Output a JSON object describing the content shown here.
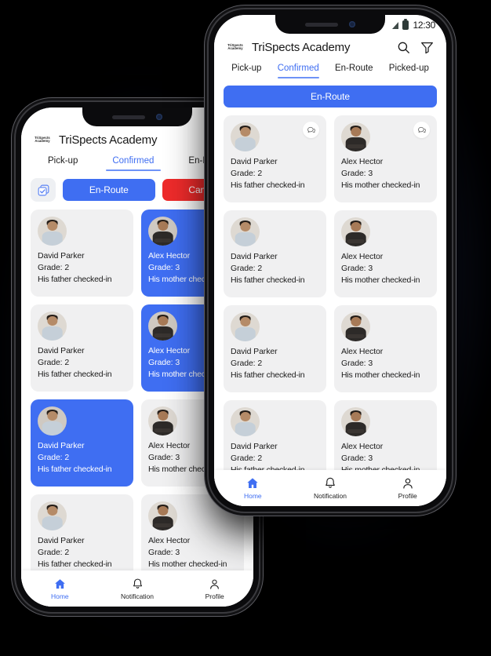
{
  "background_color": "#000000",
  "accent_color": "#3f6ef2",
  "danger_color": "#ee2b2b",
  "card_color": "#f0f0f1",
  "status_bar": {
    "time": "12:30",
    "signal_icon": "signal-icon",
    "battery_icon": "battery-icon"
  },
  "header": {
    "logo_line1": "TriSpects",
    "logo_line2": "Academy",
    "title": "TriSpects Academy",
    "search_icon": "search-icon",
    "filter_icon": "filter-icon"
  },
  "tabs": [
    {
      "label": "Pick-up",
      "active": false
    },
    {
      "label": "Confirmed",
      "active": true
    },
    {
      "label": "En-Route",
      "active": false
    },
    {
      "label": "Picked-up",
      "active": false
    }
  ],
  "front_phone": {
    "primary_action": {
      "label": "En-Route"
    }
  },
  "back_phone": {
    "select_all_icon": "select-all-checkbox-icon",
    "primary_action": {
      "label": "En-Route"
    },
    "secondary_action": {
      "label": "Cancel"
    }
  },
  "students": {
    "david": {
      "name": "David Parker",
      "grade": "Grade: 2",
      "status": "His father checked-in",
      "avatar": "david-avatar"
    },
    "alex": {
      "name": "Alex Hector",
      "grade": "Grade: 3",
      "status": "His mother checked-in",
      "avatar": "alex-avatar"
    }
  },
  "front_cards": [
    {
      "student": "david",
      "selected": false,
      "chat": true
    },
    {
      "student": "alex",
      "selected": false,
      "chat": true
    },
    {
      "student": "david",
      "selected": false,
      "chat": false
    },
    {
      "student": "alex",
      "selected": false,
      "chat": false
    },
    {
      "student": "david",
      "selected": false,
      "chat": false
    },
    {
      "student": "alex",
      "selected": false,
      "chat": false
    },
    {
      "student": "david",
      "selected": false,
      "chat": false
    },
    {
      "student": "alex",
      "selected": false,
      "chat": false
    }
  ],
  "back_cards": [
    {
      "student": "david",
      "selected": false,
      "chat": false
    },
    {
      "student": "alex",
      "selected": true,
      "chat": false
    },
    {
      "student": "david",
      "selected": false,
      "chat": false
    },
    {
      "student": "alex",
      "selected": true,
      "chat": false
    },
    {
      "student": "david",
      "selected": true,
      "chat": false
    },
    {
      "student": "alex",
      "selected": false,
      "chat": false
    },
    {
      "student": "david",
      "selected": false,
      "chat": false
    },
    {
      "student": "alex",
      "selected": false,
      "chat": false
    }
  ],
  "bottom_nav": [
    {
      "label": "Home",
      "icon": "home-icon",
      "active": true
    },
    {
      "label": "Notification",
      "icon": "bell-icon",
      "active": false
    },
    {
      "label": "Profile",
      "icon": "person-icon",
      "active": false
    }
  ]
}
